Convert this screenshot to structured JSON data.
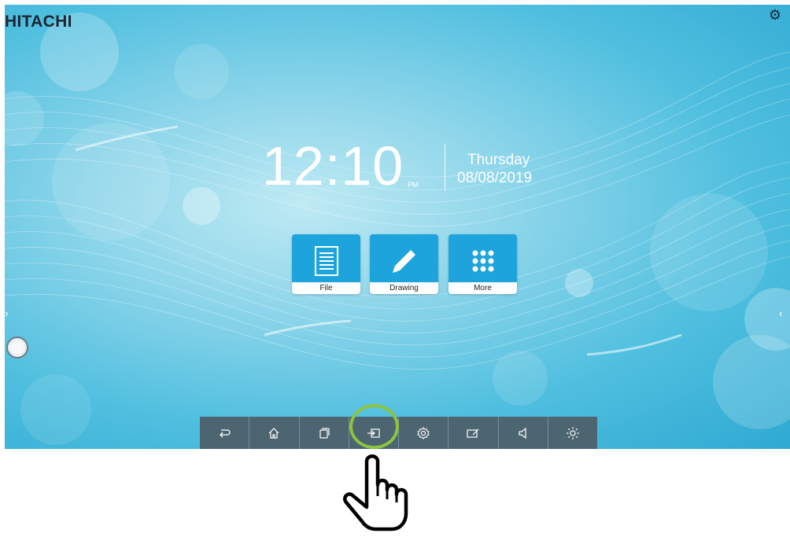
{
  "header": {
    "brand": "HITACHI",
    "settings_icon": "gear-icon"
  },
  "clock": {
    "time": "12:10",
    "ampm": "PM",
    "day": "Thursday",
    "date": "08/08/2019"
  },
  "apps": [
    {
      "label": "File",
      "icon": "file-icon"
    },
    {
      "label": "Drawing",
      "icon": "pencil-icon"
    },
    {
      "label": "More",
      "icon": "grid-icon"
    }
  ],
  "taskbar": [
    {
      "name": "back",
      "icon": "back-icon"
    },
    {
      "name": "home",
      "icon": "home-icon"
    },
    {
      "name": "recent",
      "icon": "recent-apps-icon"
    },
    {
      "name": "input",
      "icon": "input-source-icon",
      "highlighted": true
    },
    {
      "name": "settings",
      "icon": "gear-icon"
    },
    {
      "name": "annotate",
      "icon": "annotate-icon"
    },
    {
      "name": "volume",
      "icon": "volume-icon"
    },
    {
      "name": "brightness",
      "icon": "brightness-icon"
    }
  ],
  "side_controls": {
    "left": "›",
    "right": "‹"
  },
  "colors": {
    "taskbar": "#4d6571",
    "app_tile": "#1ea4dc",
    "highlight": "#8bc53f"
  }
}
